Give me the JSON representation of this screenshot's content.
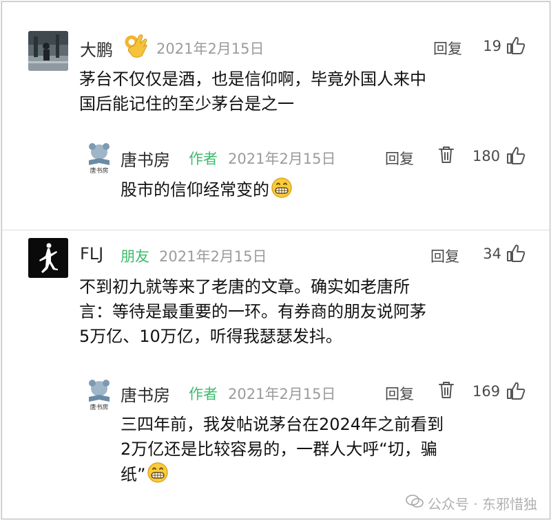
{
  "comments": [
    {
      "author": "大鹏",
      "date": "2021年2月15日",
      "reply_label": "回复",
      "likes": "19",
      "text_lines": [
        "茅台不仅仅是酒，也是信仰啊，毕竟外国人来中",
        "国后能记住的至少茅台是之一"
      ],
      "reply": {
        "author": "唐书房",
        "author_tag": "作者",
        "avatar_caption": "唐书房",
        "date": "2021年2月15日",
        "reply_label": "回复",
        "likes": "180",
        "text_lines": [
          "股市的信仰经常变的"
        ]
      }
    },
    {
      "author": "FLJ",
      "author_tag": "朋友",
      "date": "2021年2月15日",
      "reply_label": "回复",
      "likes": "34",
      "text_lines": [
        "不到初九就等来了老唐的文章。确实如老唐所",
        "言：等待是最重要的一环。有券商的朋友说阿茅",
        "5万亿、10万亿，听得我瑟瑟发抖。"
      ],
      "reply": {
        "author": "唐书房",
        "author_tag": "作者",
        "avatar_caption": "唐书房",
        "date": "2021年2月15日",
        "reply_label": "回复",
        "likes": "169",
        "text_lines": [
          "三四年前，我发帖说茅台在2024年之前看到",
          "2万亿还是比较容易的，一群人大呼“切，骗",
          "纸”"
        ]
      }
    }
  ],
  "watermark": "公众号 · 东邪惜独",
  "colors": {
    "tag_green": "#3dbb6c",
    "date_gray": "#9b9b9b"
  }
}
